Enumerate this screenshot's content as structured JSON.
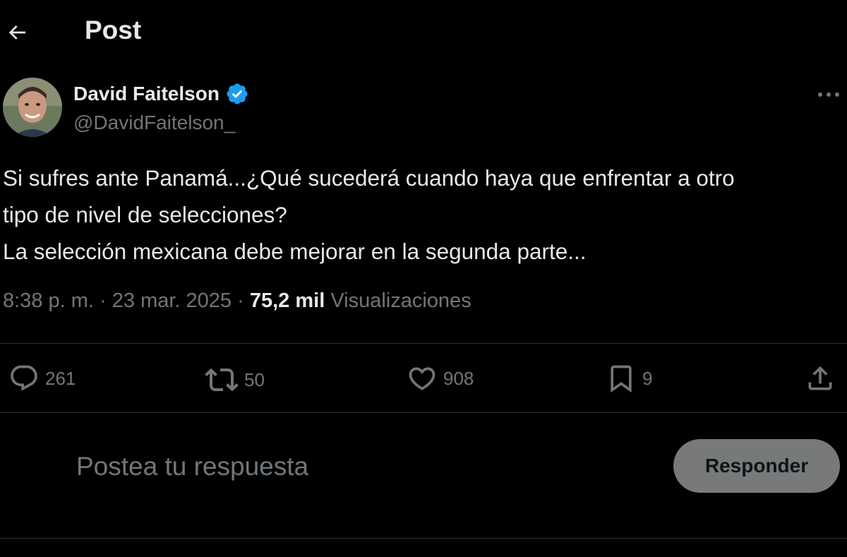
{
  "header": {
    "title": "Post",
    "back_icon": "arrow-left-icon"
  },
  "post": {
    "author": {
      "display_name": "David Faitelson",
      "handle": "@DavidFaitelson_",
      "verified": true,
      "verified_color": "#1d9bf0"
    },
    "text_lines": [
      "Si sufres ante Panamá...¿Qué sucederá cuando haya que enfrentar a otro",
      "tipo de nivel de selecciones?",
      "La selección mexicana debe mejorar en la segunda parte..."
    ],
    "meta": {
      "time": "8:38 p. m.",
      "date": "23 mar. 2025",
      "separator": "·",
      "views_count": "75,2 mil",
      "views_label": "Visualizaciones"
    },
    "actions": {
      "replies": "261",
      "reposts": "50",
      "likes": "908",
      "bookmarks": "9"
    }
  },
  "reply": {
    "placeholder": "Postea tu respuesta",
    "button_label": "Responder"
  },
  "colors": {
    "background": "#000000",
    "text_primary": "#e7e9ea",
    "text_secondary": "#71767b",
    "divider": "#2f3336",
    "reply_button_bg": "#787a7a",
    "verified": "#1d9bf0"
  }
}
